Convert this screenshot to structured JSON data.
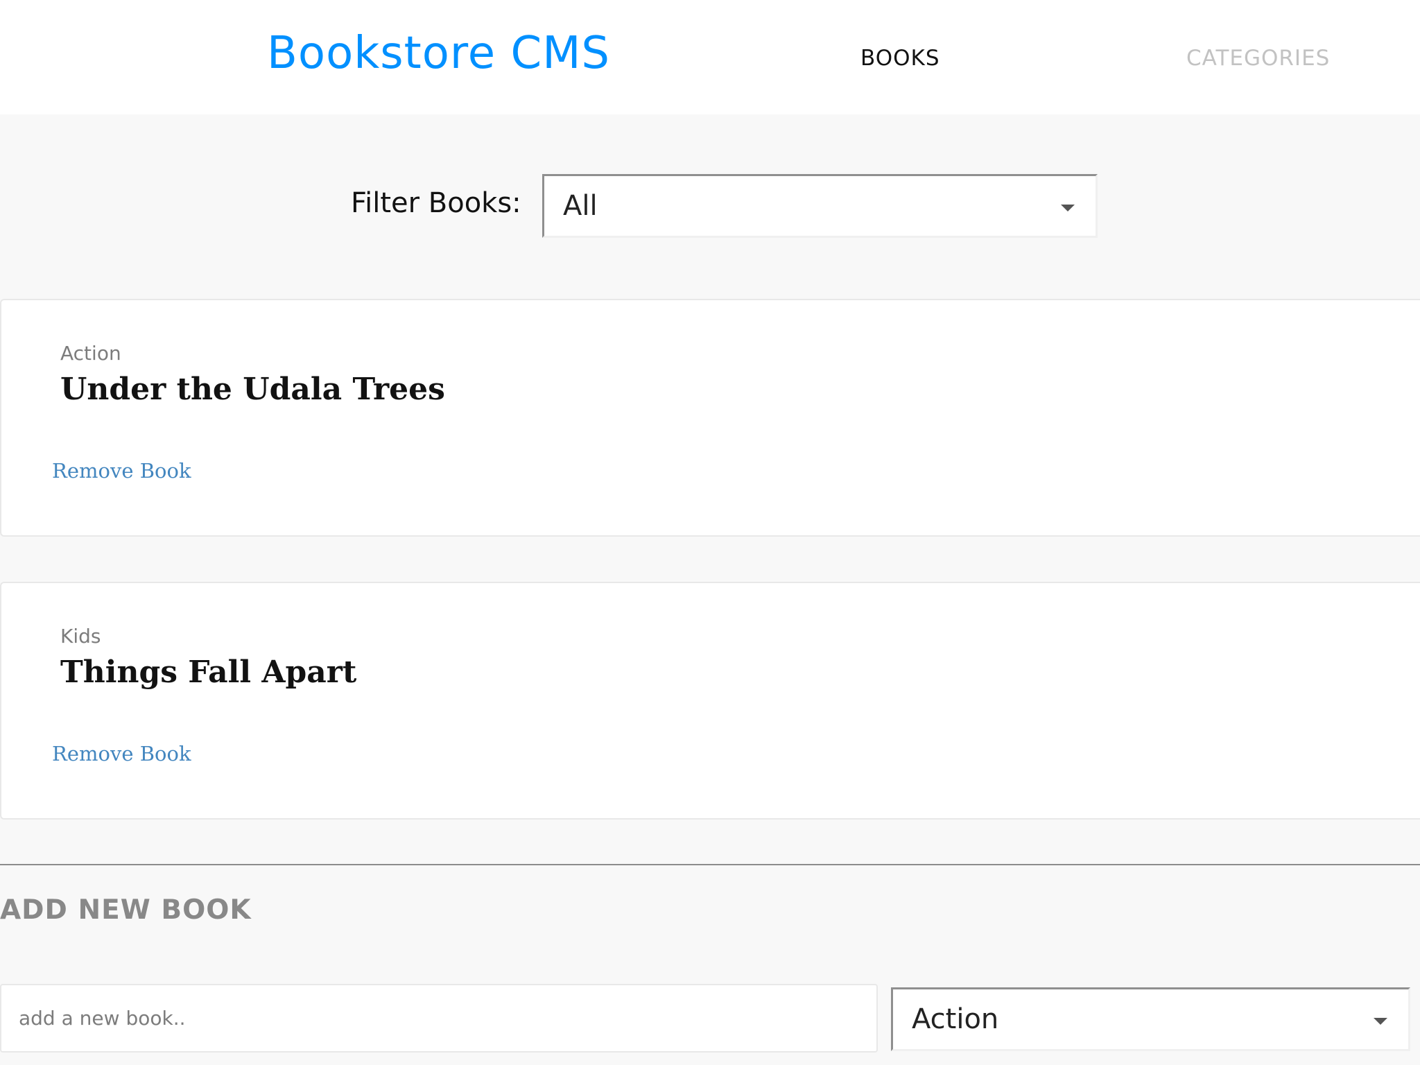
{
  "header": {
    "logo": "Bookstore CMS",
    "nav": {
      "books": "BOOKS",
      "categories": "CATEGORIES"
    }
  },
  "filter": {
    "label": "Filter Books:",
    "selected": "All"
  },
  "books": [
    {
      "category": "Action",
      "title": "Under the Udala Trees",
      "remove_label": "Remove Book"
    },
    {
      "category": "Kids",
      "title": "Things Fall Apart",
      "remove_label": "Remove Book"
    }
  ],
  "add_book": {
    "heading": "ADD NEW BOOK",
    "input_placeholder": "add a new book..",
    "input_value": "",
    "category_selected": "Action"
  },
  "colors": {
    "brand": "#0290ff",
    "link": "#4386bf",
    "nav_active": "#121212",
    "nav_inactive": "#c2c2c2",
    "background": "#f8f8f8"
  },
  "icons": {
    "select_arrow": "chevron-down-icon"
  }
}
